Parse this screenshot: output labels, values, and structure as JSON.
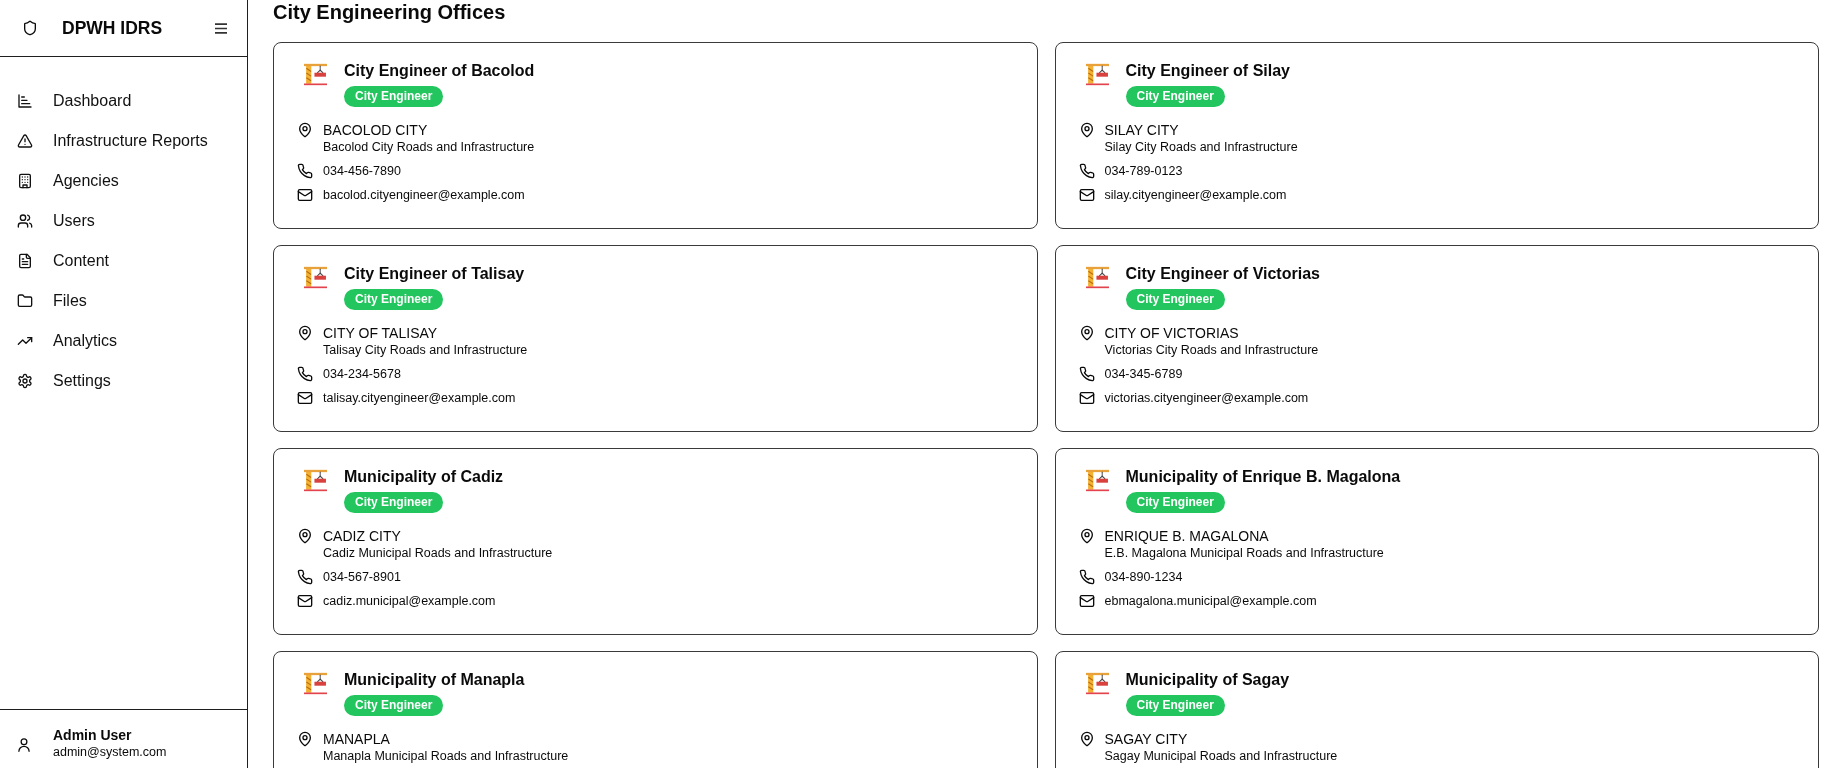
{
  "sidebar": {
    "brand": "DPWH IDRS",
    "nav": [
      {
        "label": "Dashboard",
        "selected": false
      },
      {
        "label": "Infrastructure Reports",
        "selected": false
      },
      {
        "label": "Agencies",
        "selected": false
      },
      {
        "label": "Users",
        "selected": false
      },
      {
        "label": "Content",
        "selected": false
      },
      {
        "label": "Files",
        "selected": false
      },
      {
        "label": "Analytics",
        "selected": false
      },
      {
        "label": "Settings",
        "selected": false
      }
    ],
    "user": {
      "name": "Admin User",
      "email": "admin@system.com"
    }
  },
  "main": {
    "title": "City Engineering Offices",
    "offices": [
      {
        "name": "City Engineer of Bacolod",
        "badge": "City Engineer",
        "location": "BACOLOD CITY",
        "description": "Bacolod City Roads and Infrastructure",
        "phone": "034-456-7890",
        "email": "bacolod.cityengineer@example.com"
      },
      {
        "name": "City Engineer of Silay",
        "badge": "City Engineer",
        "location": "SILAY CITY",
        "description": "Silay City Roads and Infrastructure",
        "phone": "034-789-0123",
        "email": "silay.cityengineer@example.com"
      },
      {
        "name": "City Engineer of Talisay",
        "badge": "City Engineer",
        "location": "CITY OF TALISAY",
        "description": "Talisay City Roads and Infrastructure",
        "phone": "034-234-5678",
        "email": "talisay.cityengineer@example.com"
      },
      {
        "name": "City Engineer of Victorias",
        "badge": "City Engineer",
        "location": "CITY OF VICTORIAS",
        "description": "Victorias City Roads and Infrastructure",
        "phone": "034-345-6789",
        "email": "victorias.cityengineer@example.com"
      },
      {
        "name": "Municipality of Cadiz",
        "badge": "City Engineer",
        "location": "CADIZ CITY",
        "description": "Cadiz Municipal Roads and Infrastructure",
        "phone": "034-567-8901",
        "email": "cadiz.municipal@example.com"
      },
      {
        "name": "Municipality of Enrique B. Magalona",
        "badge": "City Engineer",
        "location": "ENRIQUE B. MAGALONA",
        "description": "E.B. Magalona Municipal Roads and Infrastructure",
        "phone": "034-890-1234",
        "email": "ebmagalona.municipal@example.com"
      },
      {
        "name": "Municipality of Manapla",
        "badge": "City Engineer",
        "location": "MANAPLA",
        "description": "Manapla Municipal Roads and Infrastructure"
      },
      {
        "name": "Municipality of Sagay",
        "badge": "City Engineer",
        "location": "SAGAY CITY",
        "description": "Sagay Municipal Roads and Infrastructure"
      }
    ]
  }
}
